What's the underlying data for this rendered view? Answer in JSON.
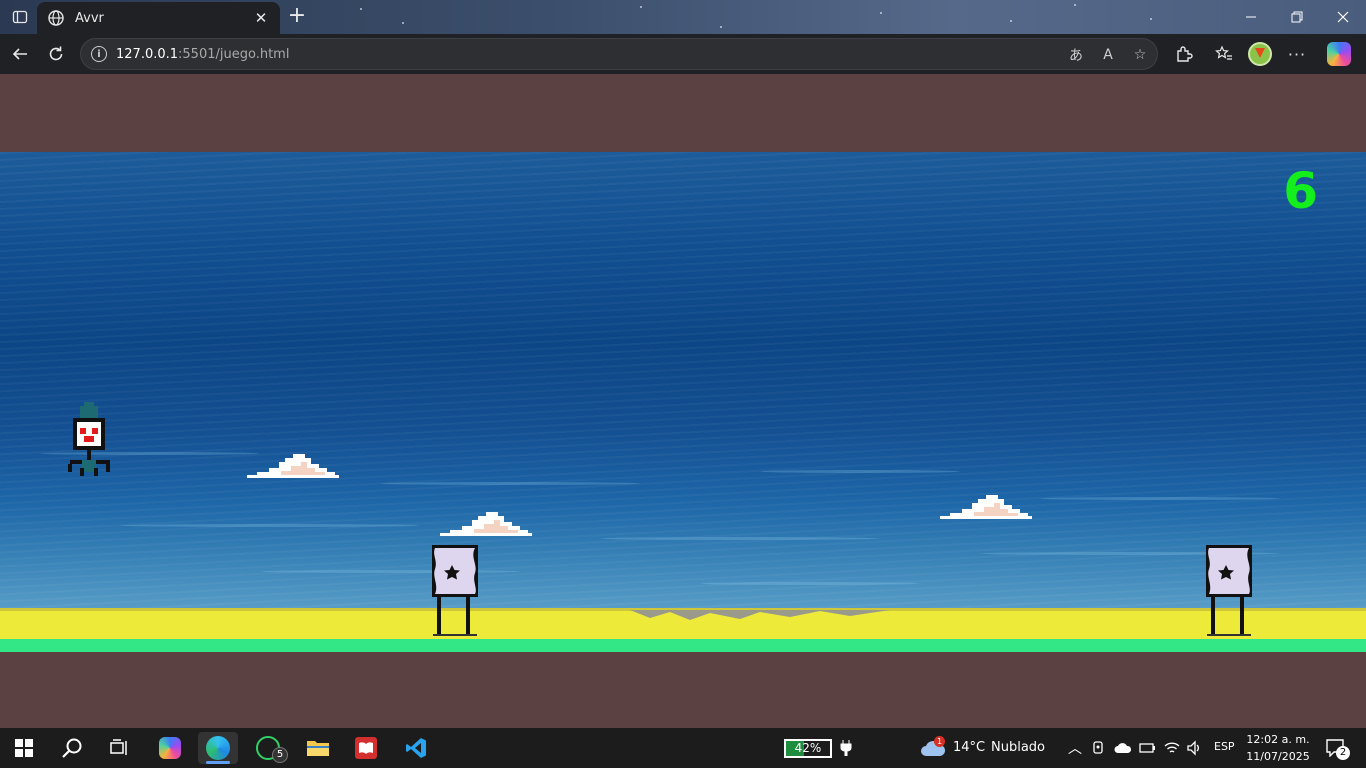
{
  "browser": {
    "tab_title": "Avvr",
    "url_host": "127.0.0.1",
    "url_path": ":5501/juego.html"
  },
  "game": {
    "score": "6",
    "colors": {
      "frame": "#5c4142",
      "sand": "#eeea3a",
      "grass": "#33e686",
      "score": "#14ee1d"
    }
  },
  "taskbar": {
    "battery_percent": "42%",
    "battery_level": 0.42,
    "weather_temp": "14°C",
    "weather_desc": "Nublado",
    "weather_badge": "1",
    "language": "ESP",
    "time": "12:02 a. m.",
    "date": "11/07/2025",
    "whatsapp_badge": "5",
    "notifications_badge": "2"
  }
}
